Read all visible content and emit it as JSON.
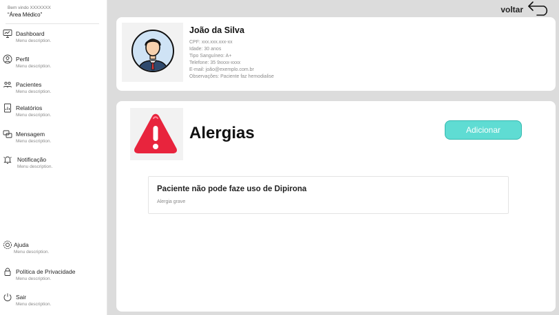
{
  "sidebar": {
    "welcome": "Bem vindo XXXXXXX",
    "area": "“Área Médico”",
    "items": [
      {
        "label": "Dashboard",
        "description": "Menu description.",
        "icon": "monitor-icon"
      },
      {
        "label": "Perfil",
        "description": "Menu description.",
        "icon": "user-icon"
      },
      {
        "label": "Pacientes",
        "description": "Menu description.",
        "icon": "users-icon"
      },
      {
        "label": "Relatórios",
        "description": "Menu description.",
        "icon": "report-icon"
      },
      {
        "label": "Mensagem",
        "description": "Menu description.",
        "icon": "message-icon"
      },
      {
        "label": "Notificação",
        "description": "Menu description.",
        "icon": "bell-icon"
      }
    ],
    "bottom_items": [
      {
        "label": "Ajuda",
        "description": "Menu description.",
        "icon": "help-icon"
      },
      {
        "label": "Política de Privacidade",
        "description": "Menu description.",
        "icon": "lock-icon"
      },
      {
        "label": "Sair",
        "description": "Menu description.",
        "icon": "power-icon"
      }
    ]
  },
  "header": {
    "back_label": "voltar"
  },
  "patient": {
    "name": "João da Silva",
    "cpf": "CPF: xxx.xxx.xxx-xx",
    "age": "Idade: 30 anos",
    "blood_type": "Tipo Sanguíneo: A+",
    "phone": "Telefone: 35 9xxxx-xxxx",
    "email": "E-mail: joão@exemplo.com.br",
    "notes": "Observações: Paciente faz hemodialise"
  },
  "allergies": {
    "title": "Alergias",
    "add_label": "Adicionar",
    "items": [
      {
        "title": "Paciente não pode faze uso de Dipirona",
        "description": "Alergia grave"
      }
    ]
  },
  "colors": {
    "accent": "#5fdcd3",
    "warning": "#e8243d"
  }
}
